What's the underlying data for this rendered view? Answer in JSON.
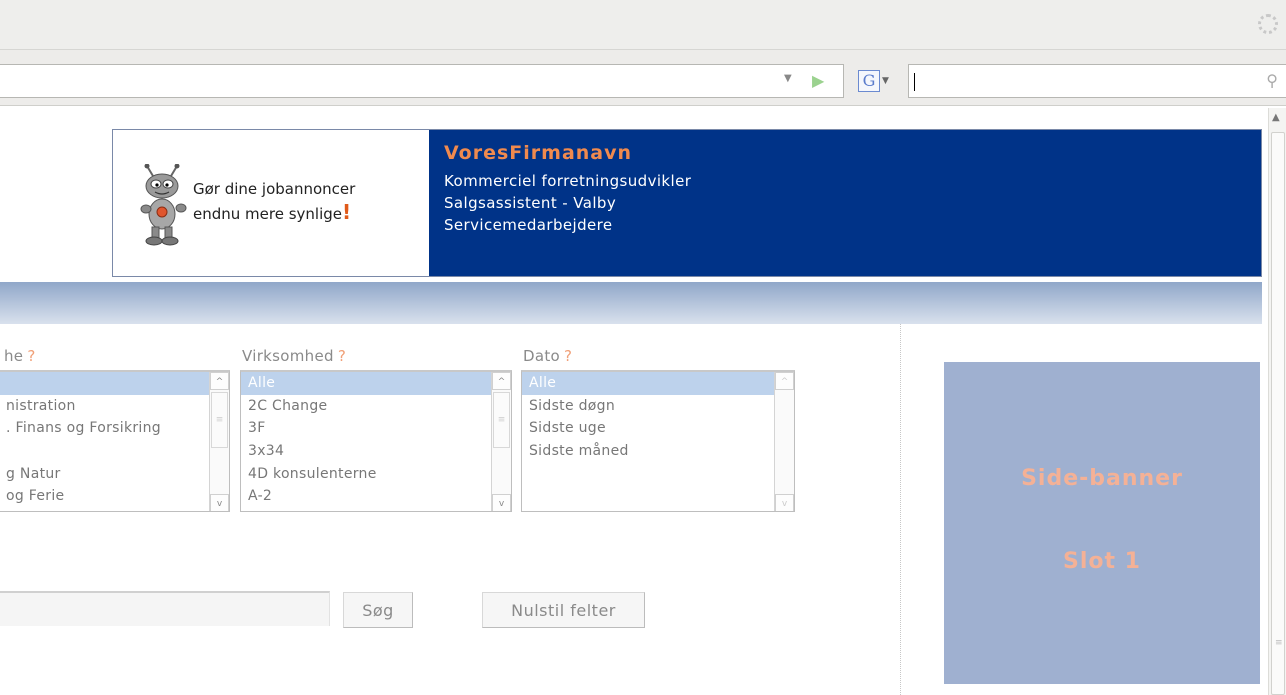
{
  "banner": {
    "promo_line1": "Gør dine jobannoncer",
    "promo_line2": "endnu mere synlige",
    "promo_exclaim": "!",
    "company": "VoresFirmanavn",
    "jobs": [
      "Kommerciel forretningsudvikler",
      "Salgsassistent - Valby",
      "Servicemedarbejdere"
    ]
  },
  "filters": {
    "help_mark": "?",
    "branche": {
      "label": "he",
      "items": [
        "",
        "nistration",
        ". Finans og Forsikring",
        "",
        "g Natur",
        "og Ferie"
      ],
      "selected_index": 0
    },
    "virksomhed": {
      "label": "Virksomhed",
      "items": [
        "Alle",
        "2C Change",
        "3F",
        "3x34",
        "4D konsulenterne",
        "A-2"
      ],
      "selected_index": 0
    },
    "dato": {
      "label": "Dato",
      "items": [
        "Alle",
        "Sidste døgn",
        "Sidste uge",
        "Sidste måned"
      ],
      "selected_index": 0
    }
  },
  "search": {
    "value": "",
    "submit_label": "Søg",
    "reset_label": "Nulstil felter"
  },
  "side_banner": {
    "line1": "Side-banner",
    "line2": "Slot 1"
  },
  "colors": {
    "banner_blue": "#003388",
    "accent_orange": "#f08a4e",
    "side_banner_bg": "#9fb0d0"
  }
}
